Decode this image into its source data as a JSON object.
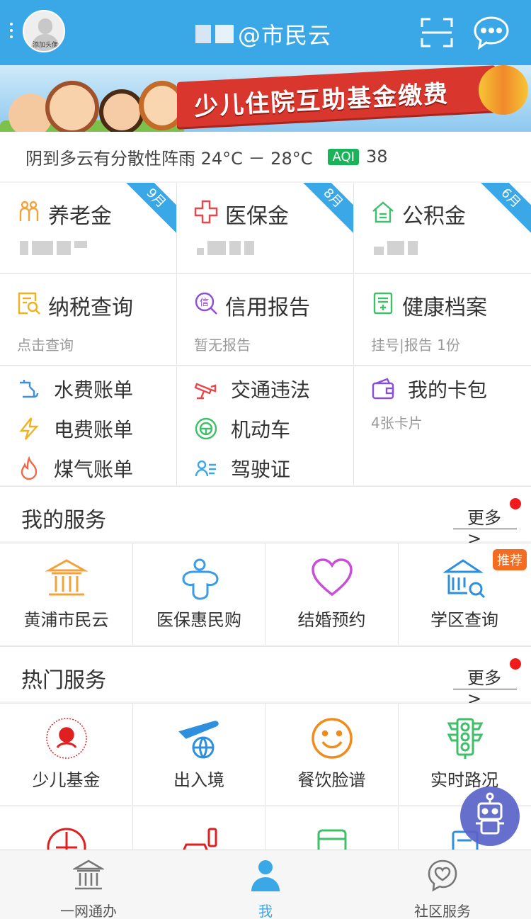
{
  "header": {
    "title": "@市民云",
    "avatar_caption": "添加头像",
    "scan_icon": "scan-icon",
    "chat_icon": "chat-bubble-icon",
    "bg_color": "#3aa8e6"
  },
  "banner": {
    "text": "少儿住院互助基金缴费"
  },
  "weather": {
    "text": "阴到多云有分散性阵雨 24°C － 28°C",
    "aqi_label": "AQI",
    "aqi_value": "38"
  },
  "cards": {
    "pension": {
      "title": "养老金",
      "corner": "9月"
    },
    "medical": {
      "title": "医保金",
      "corner": "8月"
    },
    "fund": {
      "title": "公积金",
      "corner": "6月"
    },
    "tax": {
      "title": "纳税查询",
      "sub": "点击查询"
    },
    "credit": {
      "title": "信用报告",
      "sub": "暂无报告"
    },
    "health": {
      "title": "健康档案",
      "sub": "挂号|报告 1份"
    }
  },
  "bills": {
    "water": "水费账单",
    "electric": "电费账单",
    "gas": "煤气账单",
    "traffic": "交通违法",
    "vehicle": "机动车",
    "license": "驾驶证",
    "wallet_title": "我的卡包",
    "wallet_sub": "4张卡片"
  },
  "my_services": {
    "title": "我的服务",
    "more": "更多 >",
    "items": [
      {
        "label": "黄浦市民云"
      },
      {
        "label": "医保惠民购"
      },
      {
        "label": "结婚预约"
      },
      {
        "label": "学区查询",
        "badge": "推荐"
      }
    ]
  },
  "hot_services": {
    "title": "热门服务",
    "more": "更多 >",
    "items": [
      {
        "label": "少儿基金"
      },
      {
        "label": "出入境"
      },
      {
        "label": "餐饮脸谱"
      },
      {
        "label": "实时路况"
      }
    ]
  },
  "nav": {
    "items": [
      {
        "label": "一网通办",
        "icon": "government-building-icon"
      },
      {
        "label": "我",
        "icon": "user-icon",
        "active": true
      },
      {
        "label": "社区服务",
        "icon": "heart-bubble-icon"
      }
    ]
  }
}
